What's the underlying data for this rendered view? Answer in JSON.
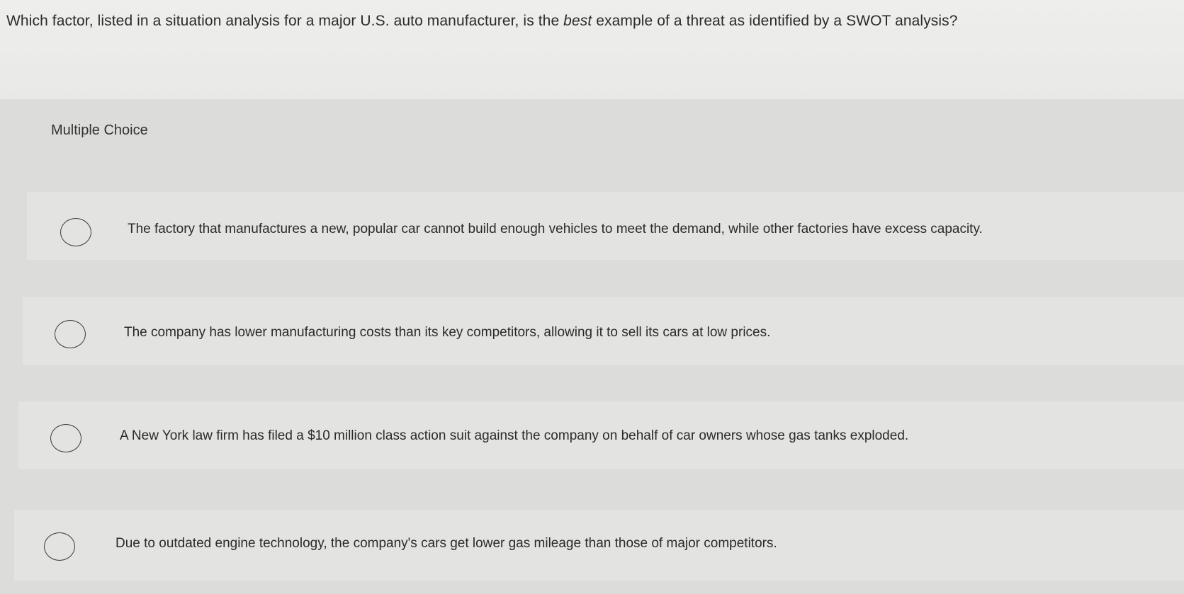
{
  "question": {
    "before_emphasis": "Which factor, listed in a situation analysis for a major U.S. auto manufacturer, is the ",
    "emphasis": "best",
    "after_emphasis": " example of a threat as identified by a SWOT analysis?"
  },
  "section_label": "Multiple Choice",
  "options": [
    {
      "text": "The factory that manufactures a new, popular car cannot build enough vehicles to meet the demand, while other factories have excess capacity."
    },
    {
      "text": "The company has lower manufacturing costs than its key competitors, allowing it to sell its cars at low prices."
    },
    {
      "text": "A New York law firm has filed a $10 million class action suit against the company on behalf of car owners whose gas tanks exploded."
    },
    {
      "text": "Due to outdated engine technology, the company's cars get lower gas mileage than those of major competitors."
    }
  ]
}
